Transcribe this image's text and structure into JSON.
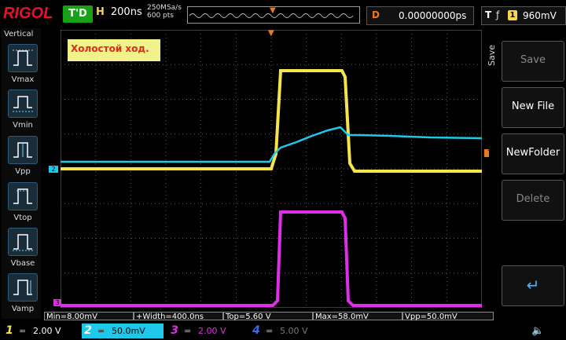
{
  "brand": "RIGOL",
  "status": "T'D",
  "horizontal": {
    "label": "H",
    "timebase": "200ns",
    "sample_rate": "250MSa/s",
    "memory_depth": "600 pts"
  },
  "delay": {
    "label": "D",
    "value": "0.00000000ps"
  },
  "trigger": {
    "label": "T",
    "edge": "ƒ",
    "source": "1",
    "level": "960mV",
    "marker": "T"
  },
  "left_panel": {
    "title": "Vertical",
    "items": [
      {
        "label": "Vmax"
      },
      {
        "label": "Vmin"
      },
      {
        "label": "Vpp"
      },
      {
        "label": "Vtop"
      },
      {
        "label": "Vbase"
      },
      {
        "label": "Vamp"
      }
    ]
  },
  "annotation": "Холостой ход.",
  "right_panel": {
    "title": "Save",
    "buttons": [
      {
        "label": "Save",
        "state": "disabled"
      },
      {
        "label": "New File",
        "state": "enabled"
      },
      {
        "label": "NewFolder",
        "state": "enabled"
      },
      {
        "label": "Delete",
        "state": "disabled"
      },
      {
        "label": "↵",
        "state": "enabled"
      }
    ]
  },
  "measurements": [
    "Min=8.00mV",
    "+Width=400.0ns",
    "Top=5.60 V",
    "Max=58.0mV",
    "Vpp=50.0mV"
  ],
  "channels": [
    {
      "num": "1",
      "coupling": "=",
      "scale": "2.00 V",
      "color": "#f7e44a"
    },
    {
      "num": "2",
      "coupling": "=",
      "scale": "50.0mV",
      "color": "#1ec8e8"
    },
    {
      "num": "3",
      "coupling": "=",
      "scale": "2.00 V",
      "color": "#e02ee8"
    },
    {
      "num": "4",
      "coupling": "=",
      "scale": "5.00 V",
      "color": "#3a6ce8"
    }
  ],
  "markers": {
    "ch2": "2",
    "ch3": "3"
  },
  "colors": {
    "ch1": "#f7e44a",
    "ch2": "#1ec8e8",
    "ch3": "#e02ee8",
    "trigger": "#f07818",
    "grid": "#5a5a5a"
  }
}
